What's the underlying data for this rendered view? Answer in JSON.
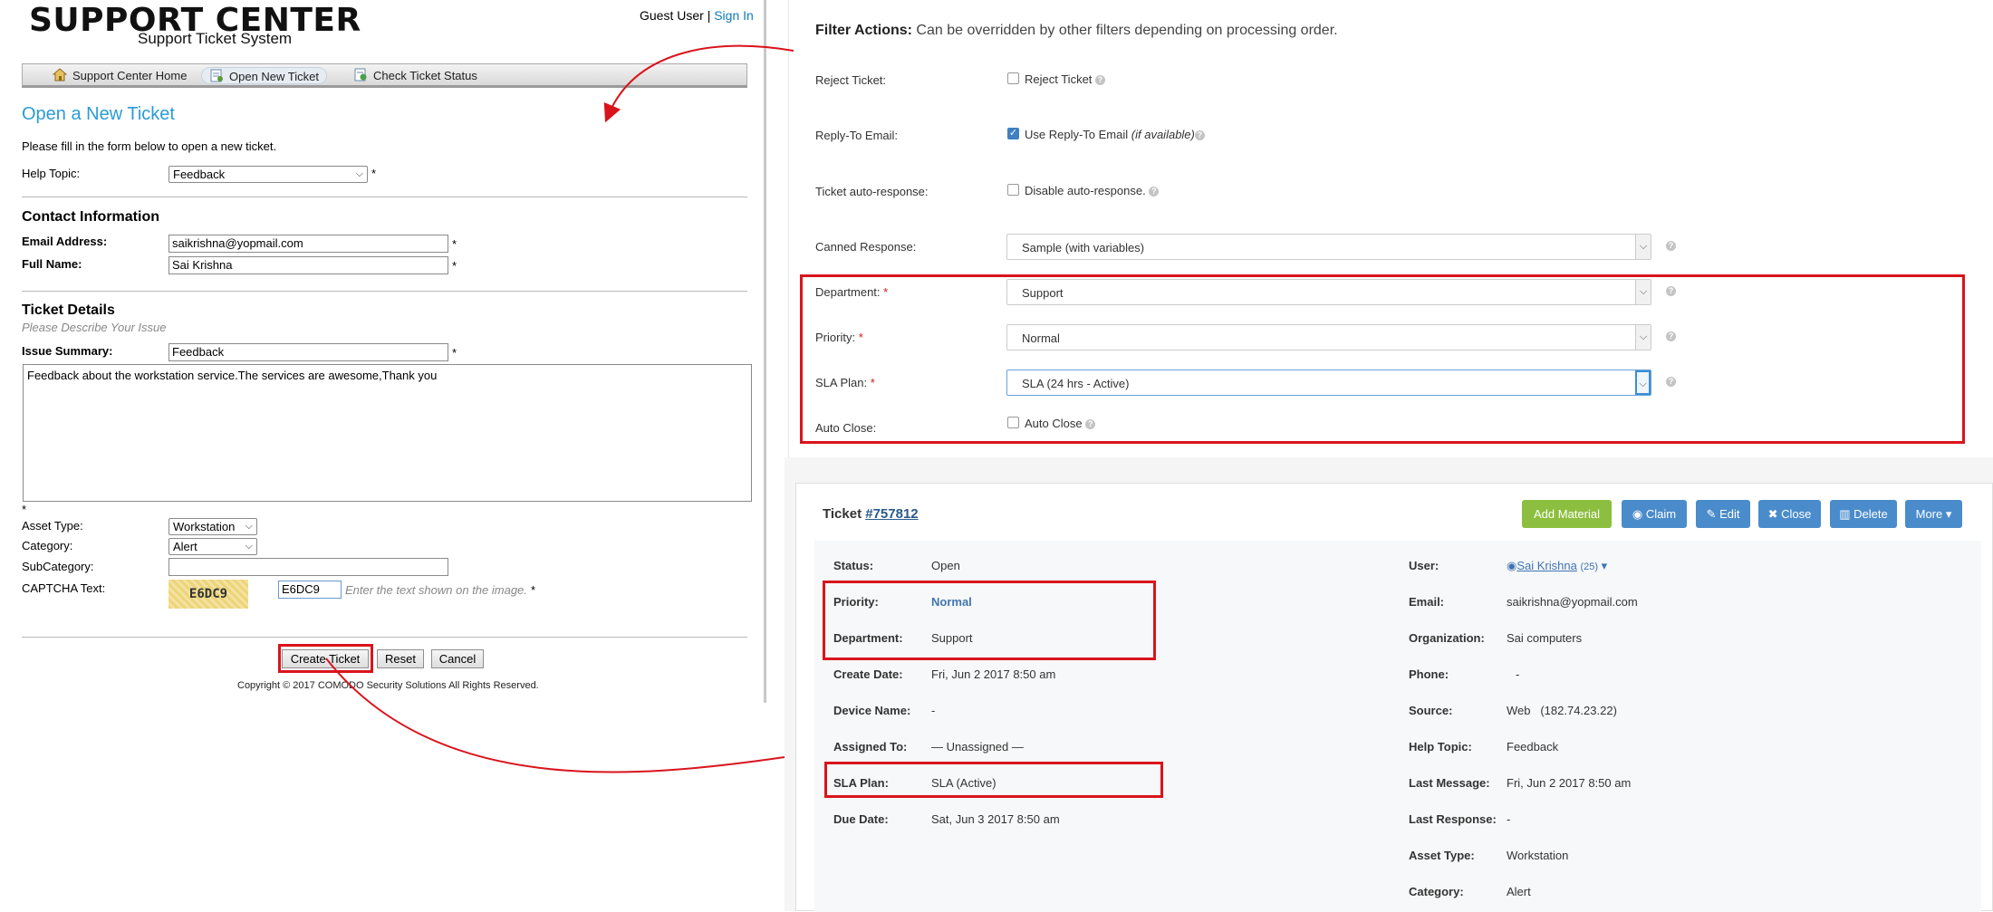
{
  "left": {
    "brand_title": "SUPPORT CENTER",
    "brand_subtitle": "Support Ticket System",
    "guest_user": "Guest User |",
    "sign_in": "Sign In",
    "nav": [
      {
        "label": "Support Center Home",
        "icon": "home-icon"
      },
      {
        "label": "Open New Ticket",
        "icon": "new-ticket-icon"
      },
      {
        "label": "Check Ticket Status",
        "icon": "ticket-status-icon"
      }
    ],
    "page_title": "Open a New Ticket",
    "intro": "Please fill in the form below to open a new ticket.",
    "help_topic_label": "Help Topic:",
    "help_topic_value": "Feedback",
    "req": "*",
    "contact_heading": "Contact Information",
    "email_label": "Email Address:",
    "email_value": "saikrishna@yopmail.com",
    "fullname_label": "Full Name:",
    "fullname_value": "Sai Krishna",
    "details_heading": "Ticket Details",
    "details_note": "Please Describe Your Issue",
    "summary_label": "Issue Summary:",
    "summary_value": "Feedback",
    "message_value": "Feedback about the workstation service.The services are awesome,Thank you",
    "asset_label": "Asset Type:",
    "asset_value": "Workstation",
    "category_label": "Category:",
    "category_value": "Alert",
    "subcategory_label": "SubCategory:",
    "subcategory_value": "",
    "captcha_label": "CAPTCHA Text:",
    "captcha_image_text": "E6DC9",
    "captcha_input": "E6DC9",
    "captcha_hint": "Enter the text shown on the image.",
    "create_btn": "Create Ticket",
    "reset_btn": "Reset",
    "cancel_btn": "Cancel",
    "copyright": "Copyright © 2017 COMODO Security Solutions All Rights Reserved."
  },
  "filter": {
    "title_bold": "Filter Actions:",
    "title_rest": " Can be overridden by other filters depending on processing order.",
    "reject_label": "Reject Ticket:",
    "reject_cb": "Reject Ticket",
    "reply_label": "Reply-To Email:",
    "reply_cb": "Use Reply-To Email",
    "reply_cb_note": "(if available)",
    "autoresp_label": "Ticket auto-response:",
    "autoresp_cb": "Disable auto-response.",
    "canned_label": "Canned Response:",
    "canned_value": "Sample (with variables)",
    "dept_label": "Department:",
    "dept_value": "Support",
    "priority_label": "Priority:",
    "priority_value": "Normal",
    "sla_label": "SLA Plan:",
    "sla_value": "SLA (24 hrs - Active)",
    "autoclose_label": "Auto Close:",
    "autoclose_cb": "Auto Close",
    "req": "*",
    "reply_checked": true
  },
  "ticket": {
    "title_prefix": "Ticket ",
    "number": "#757812",
    "buttons": {
      "add_material": "Add Material",
      "claim": "Claim",
      "edit": "Edit",
      "close": "Close",
      "delete": "Delete",
      "more": "More"
    },
    "left_fields": [
      {
        "k": "Status:",
        "v": "Open"
      },
      {
        "k": "Priority:",
        "v": "Normal"
      },
      {
        "k": "Department:",
        "v": "Support"
      },
      {
        "k": "Create Date:",
        "v": "Fri, Jun 2 2017 8:50 am"
      },
      {
        "k": "Device Name:",
        "v": "-"
      },
      {
        "k": "Assigned To:",
        "v": "— Unassigned —"
      },
      {
        "k": "SLA Plan:",
        "v": "SLA (Active)"
      },
      {
        "k": "Due Date:",
        "v": "Sat, Jun 3 2017 8:50 am"
      }
    ],
    "right_fields": [
      {
        "k": "User:",
        "v": "Sai Krishna",
        "extra": "(25)"
      },
      {
        "k": "Email:",
        "v": "saikrishna@yopmail.com"
      },
      {
        "k": "Organization:",
        "v": "Sai computers"
      },
      {
        "k": "Phone:",
        "v": "-"
      },
      {
        "k": "Source:",
        "v": "Web   (182.74.23.22)"
      },
      {
        "k": "Help Topic:",
        "v": "Feedback"
      },
      {
        "k": "Last Message:",
        "v": "Fri, Jun 2 2017 8:50 am"
      },
      {
        "k": "Last Response:",
        "v": "-"
      },
      {
        "k": "Asset Type:",
        "v": "Workstation"
      },
      {
        "k": "Category:",
        "v": "Alert"
      }
    ]
  },
  "colors": {
    "highlight": "#d9141c",
    "accent": "#2a9bd6",
    "green_btn": "#8cbf3f",
    "blue_btn": "#4a8ccb"
  }
}
